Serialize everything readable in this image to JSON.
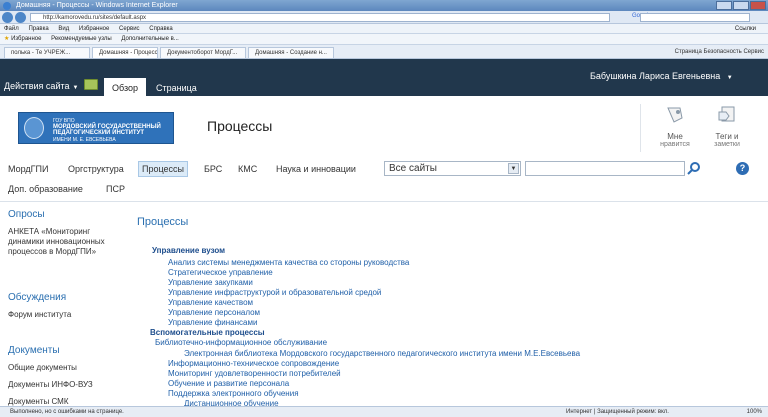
{
  "browser": {
    "window_title": "Домашняя - Процессы - Windows Internet Explorer",
    "url": "http://kamorovedu.ru/sites/default.aspx",
    "search_engine": "Google",
    "menu_items": [
      "Файл",
      "Правка",
      "Вид",
      "Избранное",
      "Сервис",
      "Справка"
    ],
    "menu_right": "Ссылки",
    "favorites_label": "Избранное",
    "favorites": [
      "Рекомендуемые узлы",
      "Дополнительные в..."
    ],
    "tabs": [
      "полька - Те УЧРЕЖ...",
      "Домашняя - Процессы",
      "Документоборот МордГ...",
      "Домашняя - Создание н..."
    ],
    "tab_tools": "Страница  Безопасность  Сервис",
    "status_text": "Выполнено, но с ошибками на странице.",
    "status_zone": "Интернет | Защищенный режим: вкл.",
    "zoom": "100%"
  },
  "ribbon": {
    "site_actions": "Действия сайта",
    "tab_browse": "Обзор",
    "tab_pages": "Страница",
    "user_name": "Бабушкина Лариса Евгеньевна"
  },
  "header": {
    "logo_line1": "ГОУ ВПО",
    "logo_line2": "МОРДОВСКИЙ ГОСУДАРСТВЕННЫЙ ПЕДАГОГИЧЕСКИЙ ИНСТИТУТ",
    "logo_line3": "ИМЕНИ М. Е. ЕВСЕВЬЕВА",
    "page_title": "Процессы",
    "like_label1": "Мне",
    "like_label2": "нравится",
    "tags_label1": "Теги и",
    "tags_label2": "заметки"
  },
  "topnav": {
    "items": [
      "МордГПИ",
      "Оргструктура",
      "Процессы",
      "БРС",
      "КМС",
      "Наука и инновации",
      "Доп. образование",
      "ПСР"
    ],
    "active_index": 2,
    "search_scope": "Все сайты"
  },
  "leftnav": {
    "sections": [
      {
        "title": "Опросы",
        "items": [
          "АНКЕТА «Мониторинг динамики инновационных процессов в МордГПИ»"
        ]
      },
      {
        "title": "Обсуждения",
        "items": [
          "Форум института"
        ]
      },
      {
        "title": "Документы",
        "items": [
          "Общие документы",
          "Документы ИНФО-ВУЗ",
          "Документы СМК"
        ]
      }
    ]
  },
  "content": {
    "title": "Процессы",
    "tree": [
      {
        "text": "Управление вузом",
        "level": 0,
        "bold": true
      },
      {
        "text": "Анализ системы менеджмента качества со стороны руководства",
        "level": 1
      },
      {
        "text": "Стратегическое управление",
        "level": 1
      },
      {
        "text": "Управление закупками",
        "level": 1
      },
      {
        "text": "Управление инфраструктурой и образовательной средой",
        "level": 1
      },
      {
        "text": "Управление качеством",
        "level": 1
      },
      {
        "text": "Управление персоналом",
        "level": 1
      },
      {
        "text": "Управление финансами",
        "level": 1
      },
      {
        "text": "Вспомогательные процессы",
        "level": 0,
        "bold": true
      },
      {
        "text": "Библиотечно-информационное обслуживание",
        "level": 1
      },
      {
        "text": "Электронная библиотека Мордовского государственного педагогического института имени М.Е.Евсевьева",
        "level": 2
      },
      {
        "text": "Информационно-техническое сопровождение",
        "level": 1
      },
      {
        "text": "Мониторинг удовлетворенности потребителей",
        "level": 1
      },
      {
        "text": "Обучение и развитие персонала",
        "level": 1
      },
      {
        "text": "Поддержка электронного обучения",
        "level": 1
      },
      {
        "text": "Дистанционное обучение",
        "level": 2
      }
    ]
  },
  "colors": {
    "ribbon_bg": "#21374c",
    "link_blue": "#1f5fa8",
    "heading_blue": "#2a6fb0",
    "logo_blue": "#2f72ba"
  }
}
